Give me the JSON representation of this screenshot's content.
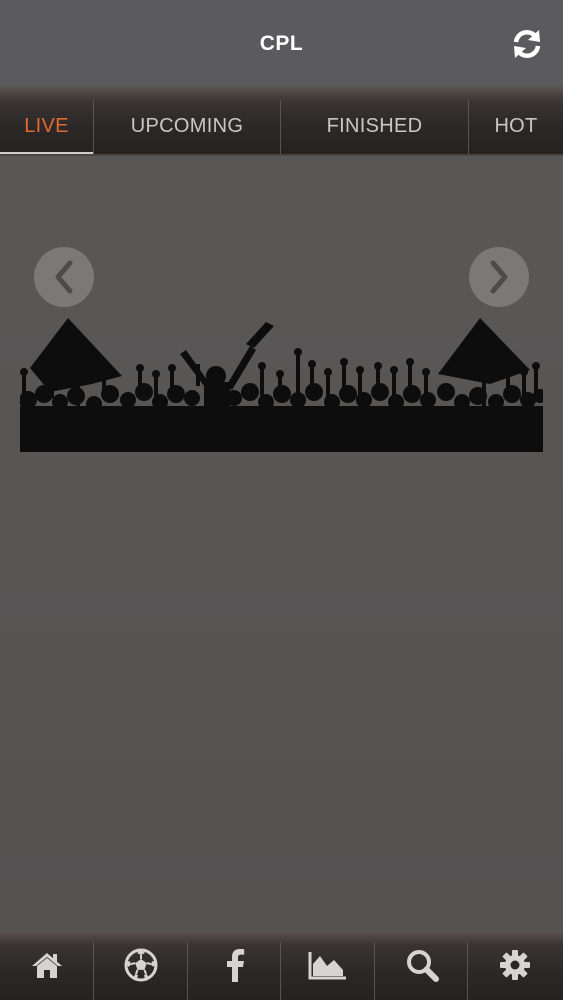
{
  "header": {
    "title": "CPL",
    "refresh_icon": "refresh-icon"
  },
  "tabs": [
    {
      "label": "LIVE",
      "active": true
    },
    {
      "label": "UPCOMING",
      "active": false
    },
    {
      "label": "FINISHED",
      "active": false
    },
    {
      "label": "HOT",
      "active": false
    }
  ],
  "carousel": {
    "prev_icon": "chevron-left-icon",
    "next_icon": "chevron-right-icon",
    "image": "crowd-silhouette"
  },
  "bottom_nav": [
    {
      "icon": "home-icon"
    },
    {
      "icon": "soccer-ball-icon"
    },
    {
      "icon": "facebook-icon"
    },
    {
      "icon": "area-chart-icon"
    },
    {
      "icon": "search-icon"
    },
    {
      "icon": "gear-icon"
    }
  ],
  "colors": {
    "active_tab": "#e06a32",
    "background": "#555454",
    "header": "#5b5a5d"
  }
}
